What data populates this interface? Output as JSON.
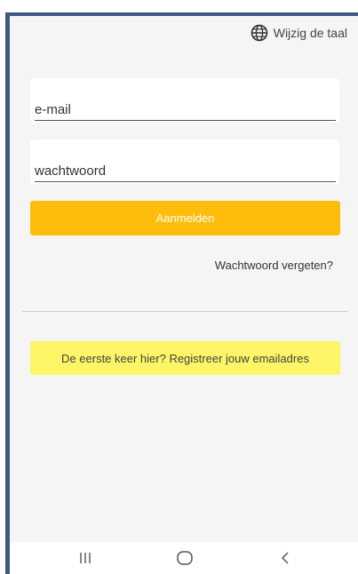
{
  "header": {
    "language_label": "Wijzig de taal",
    "language_icon": "globe-icon"
  },
  "login_form": {
    "email_placeholder": "e-mail",
    "password_placeholder": "wachtwoord",
    "login_label": "Aanmelden",
    "forgot_password_label": "Wachtwoord vergeten?"
  },
  "register": {
    "label": "De eerste keer hier? Registreer jouw emailadres"
  },
  "navbar": {
    "recent_icon": "recent-apps-icon",
    "home_icon": "home-icon",
    "back_icon": "back-icon"
  },
  "colors": {
    "login_button": "#fdbd0a",
    "register_button": "#fbf567",
    "background": "#f5f5f5",
    "frame": "#3e5a83"
  }
}
